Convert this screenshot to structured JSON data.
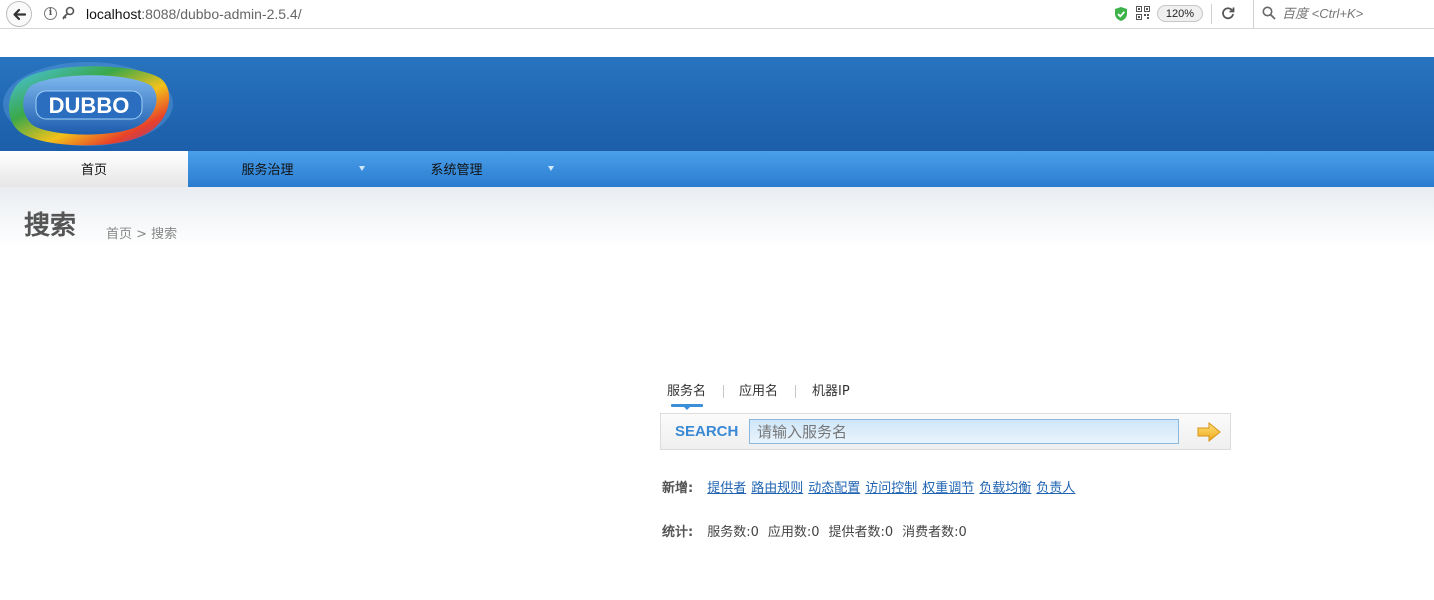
{
  "browser": {
    "url_host": "localhost",
    "url_rest": ":8088/dubbo-admin-2.5.4/",
    "zoom": "120%",
    "search_placeholder": "百度 <Ctrl+K>"
  },
  "header": {
    "logo_text": "DUBBO"
  },
  "nav": {
    "items": [
      {
        "label": "首页",
        "active": true
      },
      {
        "label": "服务治理",
        "has_dropdown": true
      },
      {
        "label": "系统管理",
        "has_dropdown": true
      }
    ]
  },
  "page": {
    "title": "搜索",
    "breadcrumb": "首页 > 搜索"
  },
  "search": {
    "tabs": [
      "服务名",
      "应用名",
      "机器IP"
    ],
    "active_tab": 0,
    "label": "SEARCH",
    "placeholder": "请输入服务名"
  },
  "add": {
    "label": "新增:",
    "links": [
      "提供者",
      "路由规则",
      "动态配置",
      "访问控制",
      "权重调节",
      "负载均衡",
      "负责人"
    ]
  },
  "stats": {
    "label": "统计:",
    "items": [
      "服务数:0",
      "应用数:0",
      "提供者数:0",
      "消费者数:0"
    ]
  },
  "colors": {
    "header_blue": "#1f65b1",
    "nav_blue": "#3b8fdf",
    "link_blue": "#1f64b2",
    "search_label": "#3a89d4"
  }
}
